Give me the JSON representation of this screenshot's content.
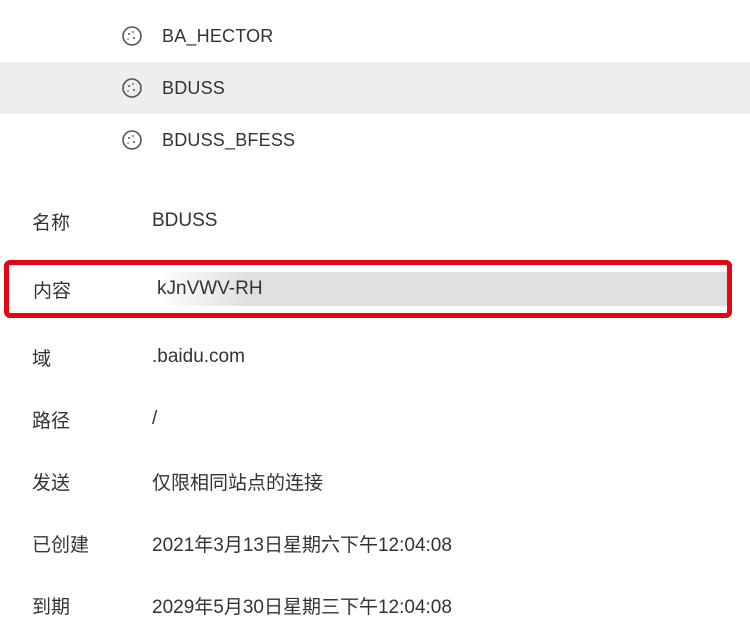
{
  "cookies": {
    "items": [
      {
        "label": "BA_HECTOR",
        "selected": false
      },
      {
        "label": "BDUSS",
        "selected": true
      },
      {
        "label": "BDUSS_BFESS",
        "selected": false
      }
    ]
  },
  "details": {
    "name_label": "名称",
    "name_value": "BDUSS",
    "content_label": "内容",
    "content_value": "kJnVWV-RH",
    "domain_label": "域",
    "domain_value": ".baidu.com",
    "path_label": "路径",
    "path_value": "/",
    "send_label": "发送",
    "send_value": "仅限相同站点的连接",
    "created_label": "已创建",
    "created_value": "2021年3月13日星期六下午12:04:08",
    "expires_label": "到期",
    "expires_value": "2029年5月30日星期三下午12:04:08"
  }
}
